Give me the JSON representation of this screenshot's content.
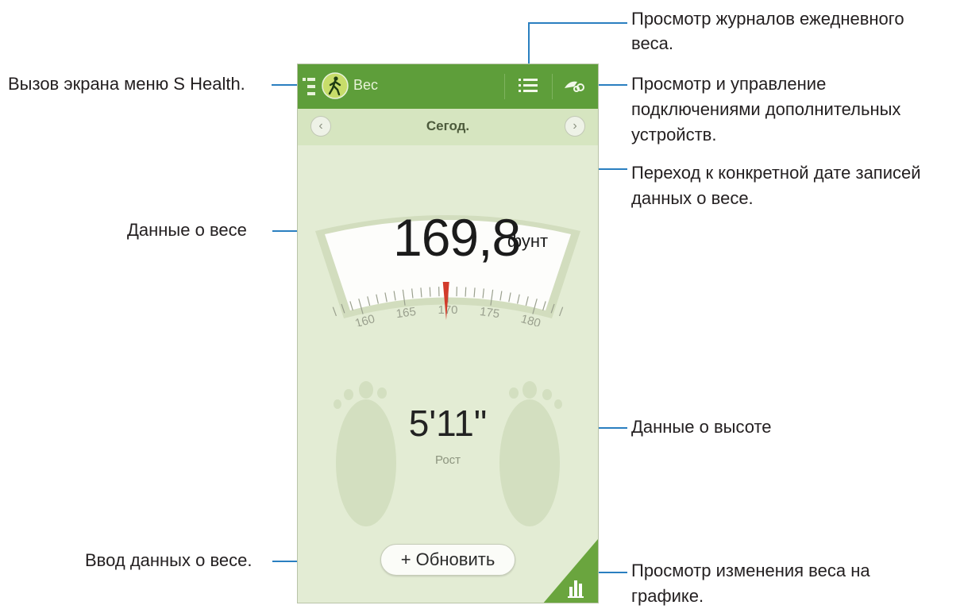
{
  "callouts": {
    "menu": "Вызов экрана меню S Health.",
    "logs_line1": "Просмотр журналов ежедневного",
    "logs_line2": "веса.",
    "devices_line1": "Просмотр и управление",
    "devices_line2": "подключениями дополнительных",
    "devices_line3": "устройств.",
    "date_line1": "Переход к конкретной дате записей",
    "date_line2": "данных о весе.",
    "weight_data": "Данные о весе",
    "height_data": "Данные о высоте",
    "enter_weight": "Ввод данных о весе.",
    "graph_line1": "Просмотр изменения веса на",
    "graph_line2": "графике."
  },
  "app": {
    "title": "Вес",
    "date": "Сегод.",
    "weight_value": "169,8",
    "weight_unit": "фунт",
    "scale_ticks": [
      "160",
      "165",
      "170",
      "175",
      "180"
    ],
    "scale_level": 169.8,
    "height_value": "5'11\"",
    "height_label": "Рост",
    "update_button": "+ Обновить"
  },
  "colors": {
    "topbar": "#5e9e3a",
    "background": "#e3ecd4",
    "needle": "#d23b2b",
    "callout_line": "#2a7fc0"
  },
  "icons": {
    "menu": "menu-icon",
    "app": "walking-person-icon",
    "logs": "list-icon",
    "devices": "accessory-link-icon",
    "prev": "chevron-left-icon",
    "next": "chevron-right-icon",
    "graph": "bar-chart-icon"
  }
}
